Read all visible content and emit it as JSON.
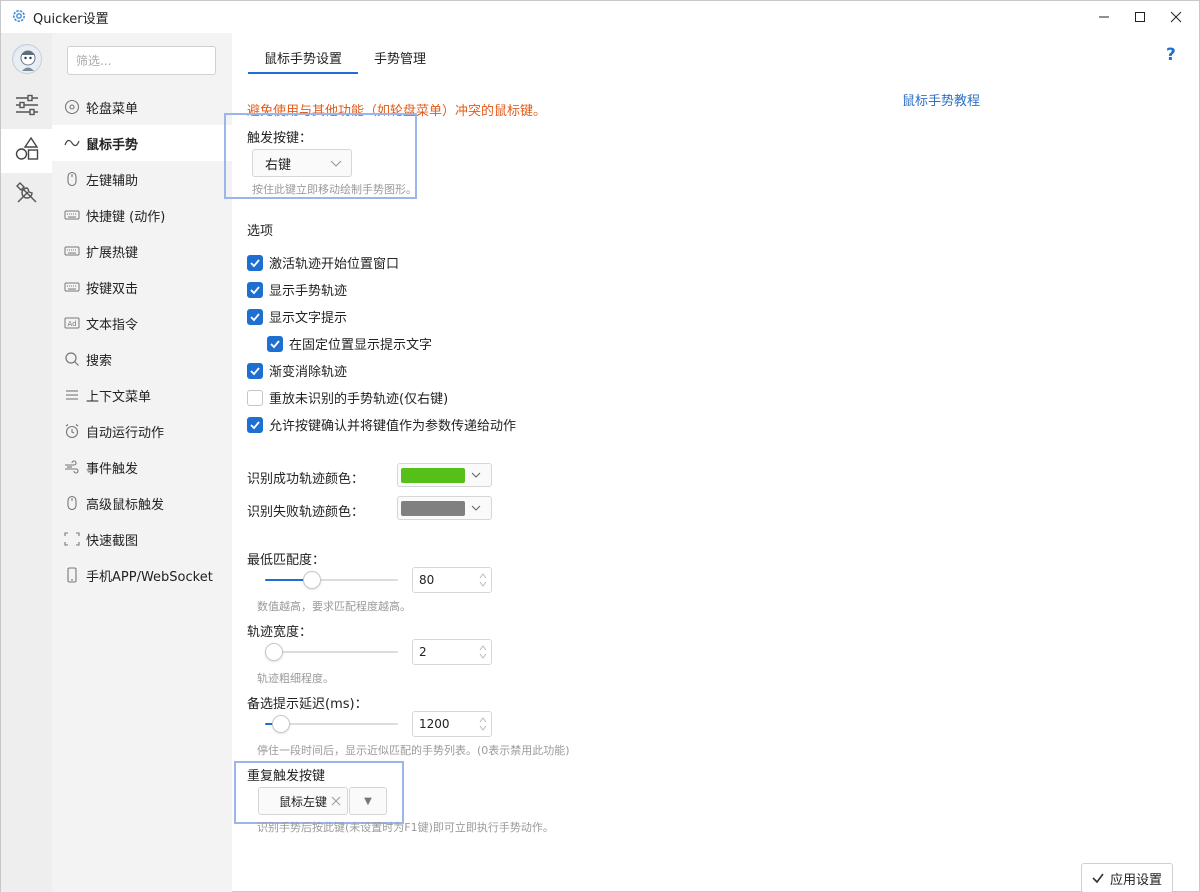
{
  "window": {
    "title": "Quicker设置"
  },
  "nav": {
    "filter_placeholder": "筛选...",
    "items": [
      {
        "label": "轮盘菜单",
        "icon": "wheel-icon"
      },
      {
        "label": "鼠标手势",
        "icon": "gesture-wave-icon"
      },
      {
        "label": "左键辅助",
        "icon": "mouse-icon"
      },
      {
        "label": "快捷键 (动作)",
        "icon": "keyboard-icon"
      },
      {
        "label": "扩展热键",
        "icon": "keyboard-icon"
      },
      {
        "label": "按键双击",
        "icon": "keyboard-icon"
      },
      {
        "label": "文本指令",
        "icon": "ad-text-icon"
      },
      {
        "label": "搜索",
        "icon": "search-icon"
      },
      {
        "label": "上下文菜单",
        "icon": "menu-lines-icon"
      },
      {
        "label": "自动运行动作",
        "icon": "alarm-clock-icon"
      },
      {
        "label": "事件触发",
        "icon": "wind-icon"
      },
      {
        "label": "高级鼠标触发",
        "icon": "mouse-icon"
      },
      {
        "label": "快速截图",
        "icon": "screenshot-frame-icon"
      },
      {
        "label": "手机APP/WebSocket",
        "icon": "phone-icon"
      }
    ]
  },
  "tabs": {
    "gesture_settings": "鼠标手势设置",
    "gesture_manage": "手势管理"
  },
  "help_label": "?",
  "content": {
    "warning": "避免使用与其他功能（如轮盘菜单）冲突的鼠标键。",
    "tutorial_link": "鼠标手势教程",
    "trigger_key_label": "触发按键：",
    "trigger_key_value": "右键",
    "trigger_key_hint": "按住此键立即移动绘制手势图形。",
    "options_title": "选项",
    "options": [
      {
        "label": "激活轨迹开始位置窗口",
        "checked": true
      },
      {
        "label": "显示手势轨迹",
        "checked": true
      },
      {
        "label": "显示文字提示",
        "checked": true
      },
      {
        "label": "在固定位置显示提示文字",
        "checked": true
      },
      {
        "label": "渐变消除轨迹",
        "checked": true
      },
      {
        "label": "重放未识别的手势轨迹(仅右键)",
        "checked": false
      },
      {
        "label": "允许按键确认并将键值作为参数传递给动作",
        "checked": true
      }
    ],
    "success_color_label": "识别成功轨迹颜色：",
    "success_color": "#55c01a",
    "fail_color_label": "识别失败轨迹颜色：",
    "fail_color": "#808080",
    "min_match_label": "最低匹配度：",
    "min_match_value": "80",
    "min_match_fraction": 0.35,
    "min_match_hint": "数值越高，要求匹配程度越高。",
    "trail_width_label": "轨迹宽度：",
    "trail_width_value": "2",
    "trail_width_fraction": 0.06,
    "trail_width_hint": "轨迹粗细程度。",
    "delay_label": "备选提示延迟(ms)：",
    "delay_value": "1200",
    "delay_fraction": 0.12,
    "delay_hint": "停住一段时间后，显示近似匹配的手势列表。(0表示禁用此功能)",
    "repeat_key_label": "重复触发按键",
    "repeat_key_value": "鼠标左键",
    "repeat_key_dropdown": "▼",
    "repeat_key_hint": "识别手势后按此键(未设置时为F1键)即可立即执行手势动作。",
    "apply_button": "应用设置"
  },
  "colors": {
    "accent": "#1f6fd1",
    "warning": "#e15c1b",
    "link": "#2d6fc2",
    "highlight_box": "#9bb6ec"
  }
}
